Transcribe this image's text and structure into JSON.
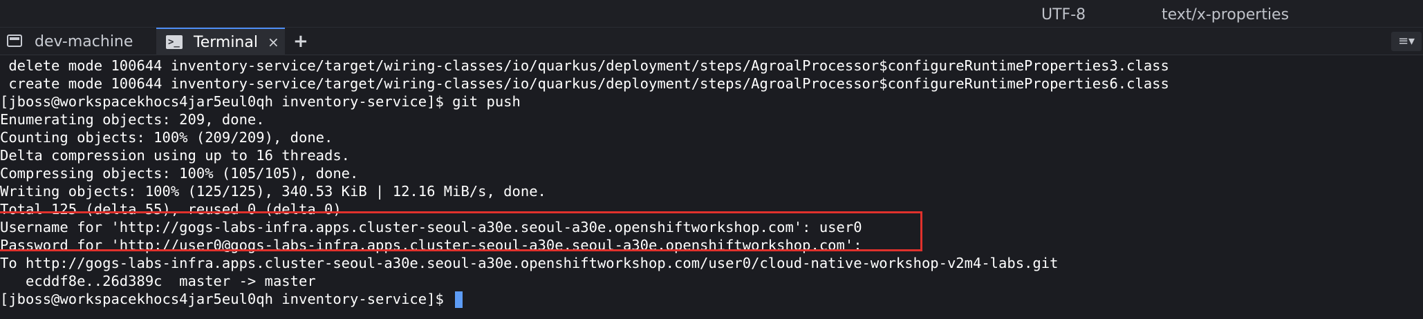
{
  "status_bar": {
    "encoding": "UTF-8",
    "mime_type": "text/x-properties"
  },
  "tabs": [
    {
      "label": "dev-machine",
      "icon": "machine-icon",
      "active": false
    },
    {
      "label": "Terminal",
      "icon": "terminal-icon",
      "active": true,
      "close": "×"
    }
  ],
  "add_tab_label": "+",
  "menu_label": "≡▾",
  "terminal": {
    "lines": [
      " delete mode 100644 inventory-service/target/wiring-classes/io/quarkus/deployment/steps/AgroalProcessor$configureRuntimeProperties3.class",
      " create mode 100644 inventory-service/target/wiring-classes/io/quarkus/deployment/steps/AgroalProcessor$configureRuntimeProperties6.class",
      "[jboss@workspacekhocs4jar5eul0qh inventory-service]$ git push",
      "Enumerating objects: 209, done.",
      "Counting objects: 100% (209/209), done.",
      "Delta compression using up to 16 threads.",
      "Compressing objects: 100% (105/105), done.",
      "Writing objects: 100% (125/125), 340.53 KiB | 12.16 MiB/s, done.",
      "Total 125 (delta 55), reused 0 (delta 0)",
      "Username for 'http://gogs-labs-infra.apps.cluster-seoul-a30e.seoul-a30e.openshiftworkshop.com': user0",
      "Password for 'http://user0@gogs-labs-infra.apps.cluster-seoul-a30e.seoul-a30e.openshiftworkshop.com':",
      "To http://gogs-labs-infra.apps.cluster-seoul-a30e.seoul-a30e.openshiftworkshop.com/user0/cloud-native-workshop-v2m4-labs.git",
      "   ecddf8e..26d389c  master -> master"
    ],
    "prompt": "[jboss@workspacekhocs4jar5eul0qh inventory-service]$ "
  },
  "colors": {
    "background": "#1b1c21",
    "text": "#ffffff",
    "cursor": "#5d9cf6",
    "highlight": "#e0312c",
    "active_tab_accent": "#4e8df5"
  }
}
